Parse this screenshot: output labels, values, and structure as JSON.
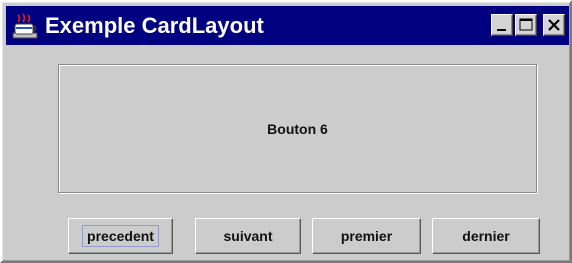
{
  "window": {
    "title": "Exemple CardLayout",
    "title_bar_color": "#000080",
    "background_color": "#cccccc",
    "icons": {
      "app": "java-app-icon",
      "minimize": "minimize-icon",
      "maximize": "maximize-icon",
      "close": "close-icon"
    }
  },
  "card": {
    "label": "Bouton 6"
  },
  "buttons": {
    "previous": "precedent",
    "next": "suivant",
    "first": "premier",
    "last": "dernier"
  }
}
